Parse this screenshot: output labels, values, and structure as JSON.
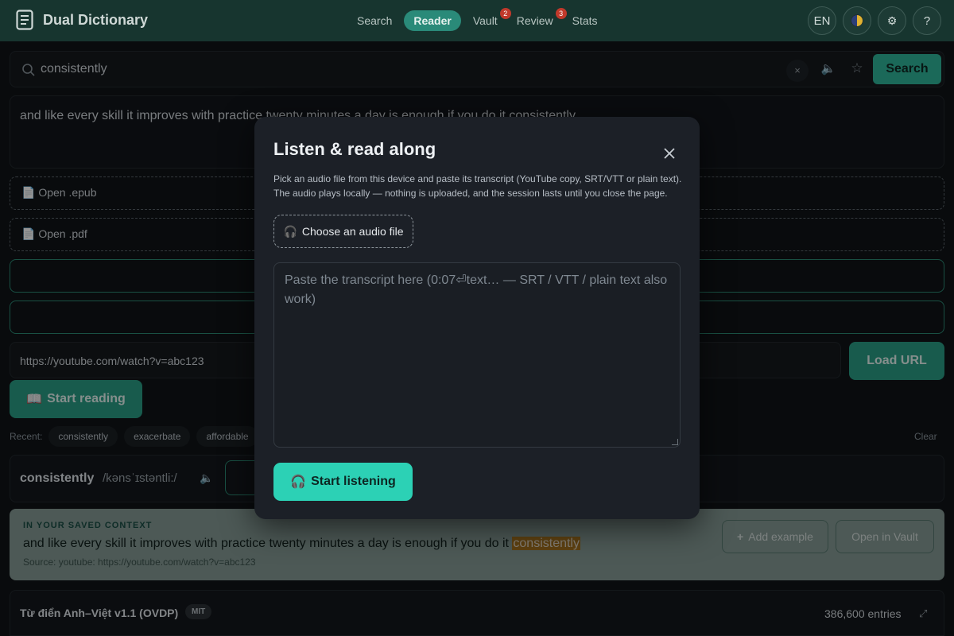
{
  "header": {
    "title": "Dual Dictionary",
    "nav": [
      {
        "label": "Search",
        "active": false,
        "badge": ""
      },
      {
        "label": "Reader",
        "active": true,
        "badge": ""
      },
      {
        "label": "Vault",
        "active": false,
        "badge": "2"
      },
      {
        "label": "Review",
        "active": false,
        "badge": "3"
      },
      {
        "label": "Stats",
        "active": false,
        "badge": ""
      }
    ],
    "lang_label": "EN",
    "theme_icon": "contrast-icon",
    "settings_icon": "gear-icon",
    "help_label": "?"
  },
  "search": {
    "value": "consistently",
    "button_label": "Search",
    "clear_label": "×"
  },
  "reader": {
    "text": "and like every skill it improves with practice twenty minutes a day is enough if you do it consistently",
    "open_epub": "Open .epub",
    "open_pdf": "Open .pdf",
    "url_value": "https://youtube.com/watch?v=abc123",
    "load_url_label": "Load URL",
    "start_reading_label": "Start reading"
  },
  "recent": {
    "label": "Recent:",
    "items": [
      "consistently",
      "exacerbate",
      "affordable"
    ],
    "clear_label": "Clear"
  },
  "word": {
    "headword": "consistently",
    "ipa": "/kənsˈɪstəntli:/"
  },
  "context": {
    "label": "IN YOUR SAVED CONTEXT",
    "text_before": "and like every skill it improves with practice twenty minutes a day is enough if you do it ",
    "highlight": "consistently",
    "source": "Source: youtube: https://youtube.com/watch?v=abc123",
    "add_example_label": "Add example",
    "open_vault_label": "Open in Vault"
  },
  "dictionary": {
    "name": "Từ điển Anh–Việt v1.1 (OVDP)",
    "license": "MIT",
    "entries": "386,600 entries"
  },
  "modal": {
    "title": "Listen & read along",
    "description": "Pick an audio file from this device and paste its transcript (YouTube copy, SRT/VTT or plain text). The audio plays locally — nothing is uploaded, and the session lasts until you close the page.",
    "choose_audio_label": "Choose an audio file",
    "transcript_placeholder": "Paste the transcript here (0:07⏎text… — SRT / VTT / plain text also work)",
    "start_listening_label": "Start listening"
  },
  "colors": {
    "accent": "#2fb59a",
    "header_bg": "#17352f",
    "highlight": "#b0781f",
    "badge": "#c0392b"
  }
}
